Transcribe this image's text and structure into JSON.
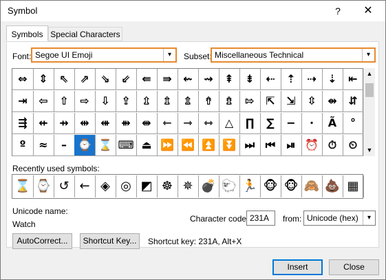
{
  "window": {
    "title": "Symbol",
    "help": "?",
    "close": "✕"
  },
  "tabs": [
    {
      "label": "Symbols"
    },
    {
      "label": "Special Characters"
    }
  ],
  "font": {
    "label": "Font:",
    "value": "Segoe UI Emoji"
  },
  "subset": {
    "label": "Subset:",
    "value": "Miscellaneous Technical"
  },
  "symbols": [
    [
      "⇔",
      "⇕",
      "⇖",
      "⇗",
      "⇘",
      "⇙",
      "⇚",
      "⇛",
      "⇜",
      "⇝",
      "⇞",
      "⇟",
      "⇠",
      "⇡",
      "⇢",
      "⇣",
      "⇤"
    ],
    [
      "⇥",
      "⇦",
      "⇧",
      "⇨",
      "⇩",
      "⇪",
      "⇫",
      "⇬",
      "⇭",
      "⇮",
      "⇯",
      "⇰",
      "⇱",
      "⇲",
      "⇳",
      "⇴",
      "⇵"
    ],
    [
      "⇶",
      "⇷",
      "⇸",
      "⇹",
      "⇺",
      "⇻",
      "⇼",
      "⇽",
      "⇾",
      "⇿",
      "△",
      "∏",
      "∑",
      "−",
      "·",
      "Ã",
      "°"
    ],
    [
      "º",
      "≈",
      "–",
      "⌚",
      "⌛",
      "⌨",
      "⏏",
      "⏩",
      "⏪",
      "⏫",
      "⏬",
      "⏭",
      "⏮",
      "⏯",
      "⏰",
      "⏱",
      "⏲"
    ]
  ],
  "selected": {
    "row": 3,
    "col": 3
  },
  "recent": {
    "label": "Recently used symbols:",
    "items": [
      "⌛",
      "⌚",
      "↺",
      "←",
      "◈",
      "◎",
      "◩",
      "☸",
      "✵",
      "💣",
      "🐑",
      "🏃",
      "🐵",
      "🐵",
      "🙈",
      "💩",
      "▦"
    ]
  },
  "unicode_name": {
    "label": "Unicode name:",
    "value": "Watch"
  },
  "char_code": {
    "label": "Character code:",
    "value": "231A"
  },
  "from": {
    "label": "from:",
    "value": "Unicode (hex)"
  },
  "buttons": {
    "autocorrect": "AutoCorrect...",
    "shortcut_key": "Shortcut Key...",
    "insert": "Insert",
    "close": "Close"
  },
  "shortcut_text": "Shortcut key: 231A, Alt+X",
  "colors": {
    "accent": "#e68a2e",
    "selection": "#1874cd",
    "default_button": "#0078d7"
  }
}
